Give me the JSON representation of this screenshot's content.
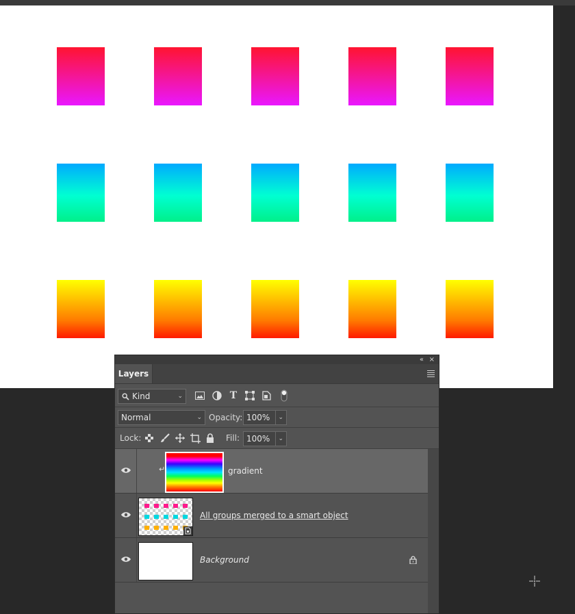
{
  "canvas": {
    "rows": [
      {
        "name": "magenta",
        "top": "#ff1430",
        "bottom": "#e917ff"
      },
      {
        "name": "cyan",
        "top": "#00aaff",
        "bottom": "#00f08a"
      },
      {
        "name": "orange",
        "top": "#ffff00",
        "bottom": "#ff1a00"
      }
    ],
    "columns": 5
  },
  "panel": {
    "collapse_icon": "«",
    "close_icon": "×",
    "tab_label": "Layers",
    "filter": {
      "kind_label": "Kind",
      "search_icon": "magnifier-icon"
    },
    "filter_icons": [
      "image-filter-icon",
      "adjustment-filter-icon",
      "type-filter-icon",
      "shape-filter-icon",
      "smart-object-filter-icon",
      "filter-toggle-icon"
    ],
    "blend_mode": "Normal",
    "opacity_label": "Opacity:",
    "opacity_value": "100%",
    "lock_label": "Lock:",
    "lock_icons": [
      "lock-transparent-icon",
      "lock-image-icon",
      "lock-position-icon",
      "lock-artboard-icon",
      "lock-all-icon"
    ],
    "fill_label": "Fill:",
    "fill_value": "100%",
    "layers": [
      {
        "name": "gradient",
        "selected": true,
        "clipped": true
      },
      {
        "name": "All groups merged to a smart object",
        "selected": false,
        "smart_object": true
      },
      {
        "name": "Background",
        "selected": false,
        "locked": true
      }
    ]
  },
  "colors": {
    "app_bg": "#282828",
    "panel_bg": "#535353",
    "selected_row": "#676767"
  }
}
